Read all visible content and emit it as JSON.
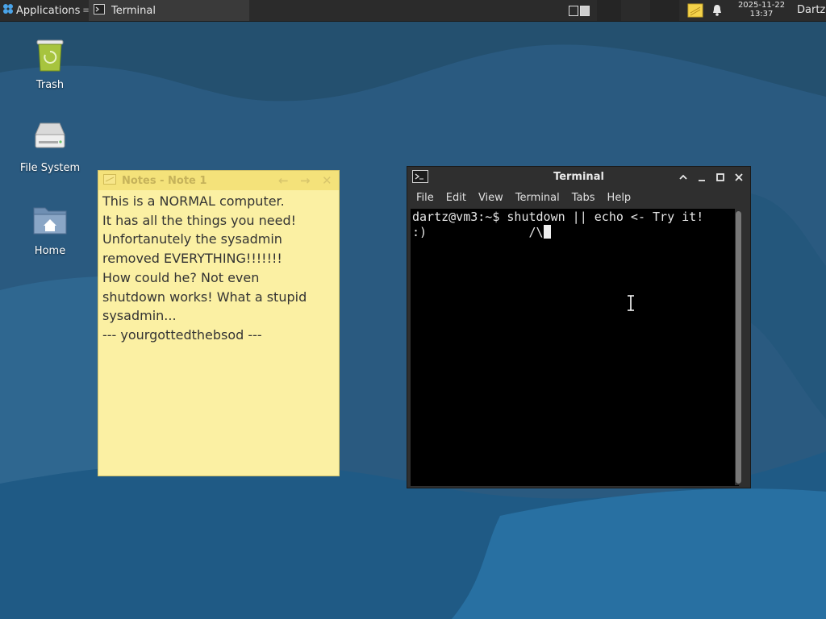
{
  "panel": {
    "applications_label": "Applications",
    "task_label": "Terminal",
    "clock_date": "2025-11-22",
    "clock_time": "13:37",
    "user": "Dartz"
  },
  "desktop": {
    "icons": [
      {
        "label": "Trash",
        "icon": "trash-icon"
      },
      {
        "label": "File System",
        "icon": "drive-icon"
      },
      {
        "label": "Home",
        "icon": "home-folder-icon"
      }
    ]
  },
  "notes": {
    "title": "Notes - Note 1",
    "text": "This is a NORMAL computer.\nIt has all the things you need!\nUnfortanutely the sysadmin\nremoved EVERYTHING!!!!!!!\nHow could he? Not even\nshutdown works! What a stupid\nsysadmin...\n--- yourgottedthebsod ---"
  },
  "terminal": {
    "title": "Terminal",
    "menu": [
      "File",
      "Edit",
      "View",
      "Terminal",
      "Tabs",
      "Help"
    ],
    "line1": "dartz@vm3:~$ shutdown || echo <- Try it!",
    "line2": ":)              /\\"
  },
  "colors": {
    "panel_bg": "#2b2b2b",
    "desktop_bg": "#2a5a80",
    "note_bg": "#fbf0a3",
    "terminal_bg": "#000000"
  }
}
